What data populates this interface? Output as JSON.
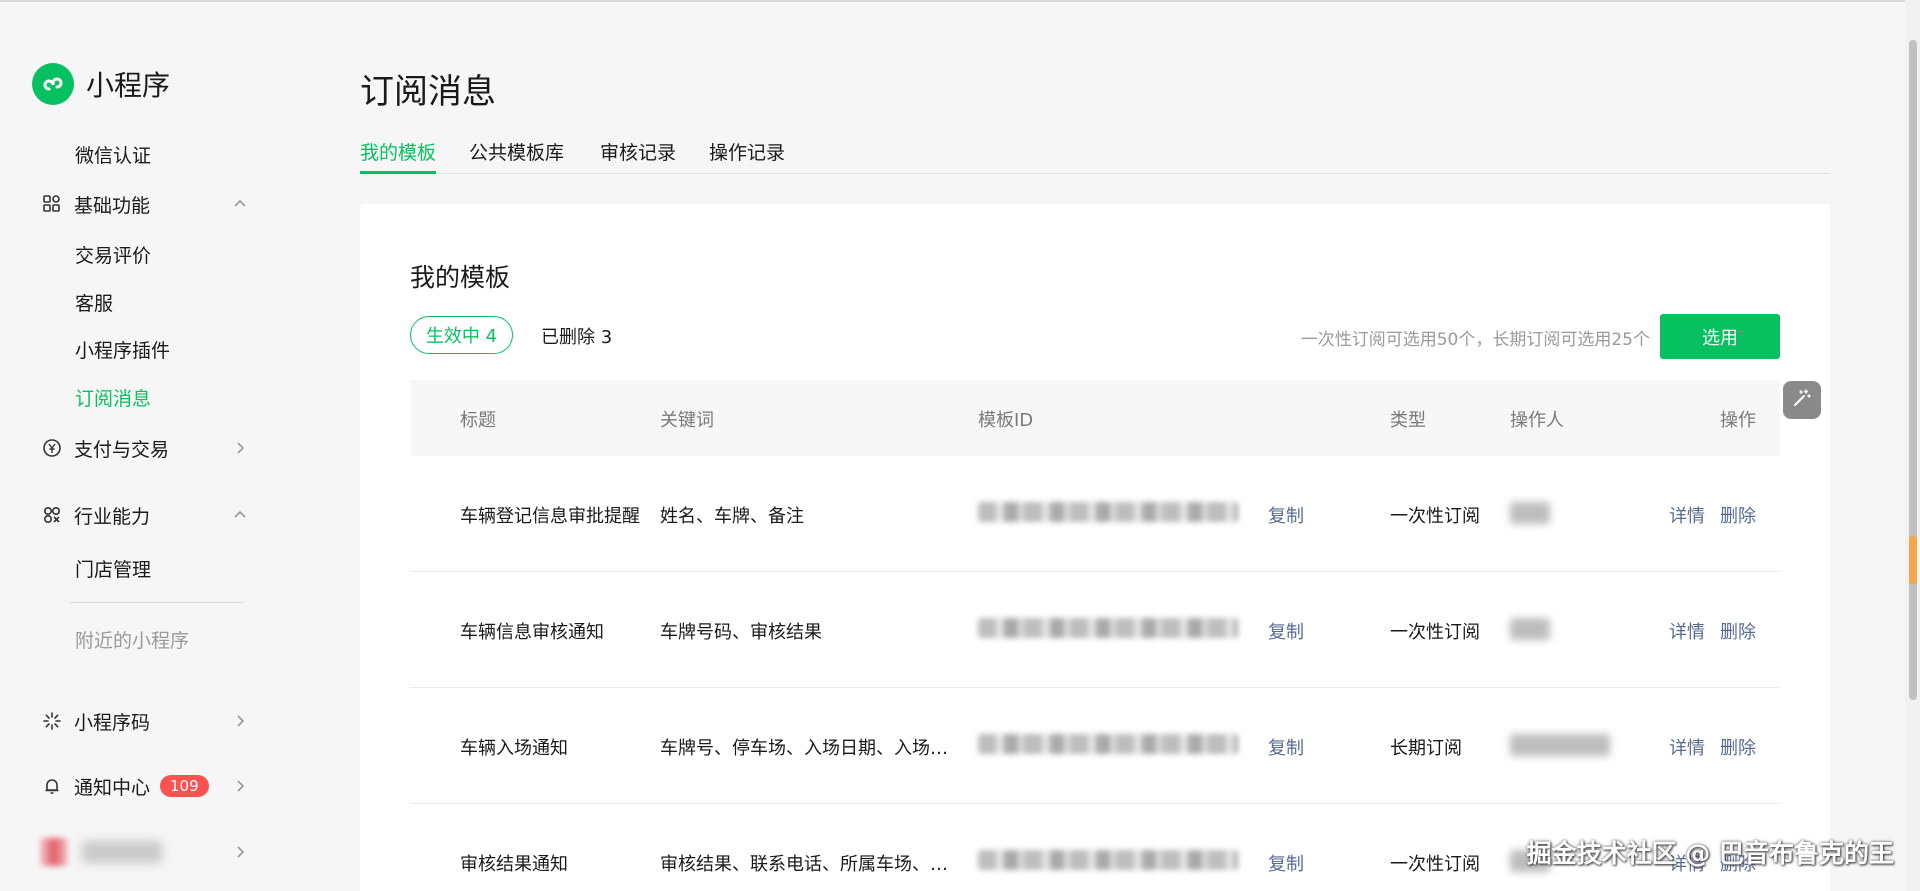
{
  "app": {
    "name": "小程序",
    "brand_color": "#07c160"
  },
  "sidebar": {
    "items": [
      {
        "label": "微信认证",
        "type": "sub"
      },
      {
        "label": "基础功能",
        "type": "group",
        "icon": "grid-icon",
        "expanded": true
      },
      {
        "label": "交易评价",
        "type": "sub"
      },
      {
        "label": "客服",
        "type": "sub"
      },
      {
        "label": "小程序插件",
        "type": "sub"
      },
      {
        "label": "订阅消息",
        "type": "sub",
        "active": true
      },
      {
        "label": "支付与交易",
        "type": "group",
        "icon": "yen-icon",
        "expanded": false
      },
      {
        "label": "行业能力",
        "type": "group",
        "icon": "industry-icon",
        "expanded": true
      },
      {
        "label": "门店管理",
        "type": "sub"
      },
      {
        "label": "附近的小程序",
        "type": "sub",
        "muted": true
      },
      {
        "label": "小程序码",
        "type": "group",
        "icon": "qrcode-icon",
        "expanded": false
      },
      {
        "label": "通知中心",
        "type": "group",
        "icon": "bell-icon",
        "badge": "109"
      }
    ]
  },
  "page": {
    "title": "订阅消息"
  },
  "tabs": [
    {
      "label": "我的模板",
      "active": true
    },
    {
      "label": "公共模板库"
    },
    {
      "label": "审核记录"
    },
    {
      "label": "操作记录"
    }
  ],
  "card": {
    "title": "我的模板",
    "status_active": "生效中 4",
    "status_deleted": "已删除 3",
    "quota": "一次性订阅可选用50个，长期订阅可选用25个",
    "select_button": "选用"
  },
  "table": {
    "headers": [
      "标题",
      "关键词",
      "模板ID",
      "类型",
      "操作人",
      "操作"
    ],
    "rows": [
      {
        "title": "车辆登记信息审批提醒",
        "keywords": "姓名、车牌、备注",
        "copy": "复制",
        "type": "一次性订阅",
        "detail": "详情",
        "delete": "删除"
      },
      {
        "title": "车辆信息审核通知",
        "keywords": "车牌号码、审核结果",
        "copy": "复制",
        "type": "一次性订阅",
        "detail": "详情",
        "delete": "删除"
      },
      {
        "title": "车辆入场通知",
        "keywords": "车牌号、停车场、入场日期、入场时...",
        "copy": "复制",
        "type": "长期订阅",
        "detail": "详情",
        "delete": "删除"
      },
      {
        "title": "审核结果通知",
        "keywords": "审核结果、联系电话、所属车场、车...",
        "copy": "复制",
        "type": "一次性订阅",
        "detail": "详情",
        "delete": "删除"
      }
    ]
  },
  "watermark": "掘金技术社区 @ 巴音布鲁克的王"
}
